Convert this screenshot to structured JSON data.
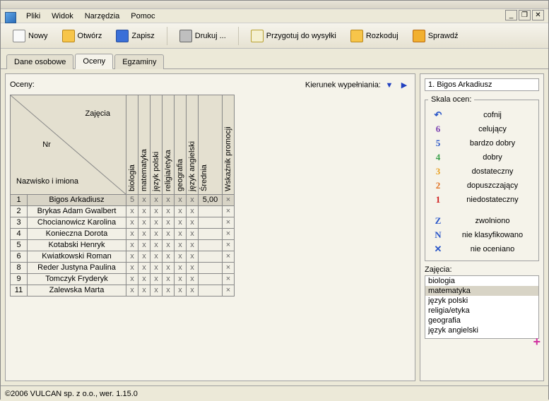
{
  "menus": [
    "Pliki",
    "Widok",
    "Narzędzia",
    "Pomoc"
  ],
  "toolbar": [
    {
      "label": "Nowy",
      "icon": "#f9f9f9",
      "border": "#888"
    },
    {
      "label": "Otwórz",
      "icon": "#f7c54a",
      "border": "#b8861a"
    },
    {
      "label": "Zapisz",
      "icon": "#3a6fd8",
      "border": "#2a4f9a"
    },
    {
      "sep": true
    },
    {
      "label": "Drukuj ...",
      "icon": "#bfbfbf",
      "border": "#666"
    },
    {
      "sep": true
    },
    {
      "label": "Przygotuj do wysyłki",
      "icon": "#f5f0d0",
      "border": "#b8a030"
    },
    {
      "label": "Rozkoduj",
      "icon": "#f7c54a",
      "border": "#b8861a"
    },
    {
      "label": "Sprawdź",
      "icon": "#f2b030",
      "border": "#b86a10"
    }
  ],
  "tabs": [
    {
      "label": "Dane osobowe",
      "active": false
    },
    {
      "label": "Oceny",
      "active": true
    },
    {
      "label": "Egzaminy",
      "active": false
    }
  ],
  "grades": {
    "label": "Oceny:",
    "direction_label": "Kierunek wypełniania:",
    "corner_top": "Zajęcia",
    "corner_nr": "Nr",
    "corner_bottom": "Nazwisko i imiona",
    "subjects": [
      "biologia",
      "matematyka",
      "język polski",
      "religia/etyka",
      "geografia",
      "język angielski"
    ],
    "avg_label": "Średnia",
    "promo_label": "Wskaźnik promocji",
    "rows": [
      {
        "nr": "1",
        "name": "Bigos Arkadiusz",
        "cells": [
          "5",
          "x",
          "x",
          "x",
          "x",
          "x"
        ],
        "avg": "5,00",
        "promo": "×",
        "hl": true
      },
      {
        "nr": "2",
        "name": "Brykas Adam Gwalbert",
        "cells": [
          "x",
          "x",
          "x",
          "x",
          "x",
          "x"
        ],
        "avg": "",
        "promo": "×"
      },
      {
        "nr": "3",
        "name": "Chocianowicz Karolina",
        "cells": [
          "x",
          "x",
          "x",
          "x",
          "x",
          "x"
        ],
        "avg": "",
        "promo": "×"
      },
      {
        "nr": "4",
        "name": "Konieczna Dorota",
        "cells": [
          "x",
          "x",
          "x",
          "x",
          "x",
          "x"
        ],
        "avg": "",
        "promo": "×"
      },
      {
        "nr": "5",
        "name": "Kotabski Henryk",
        "cells": [
          "x",
          "x",
          "x",
          "x",
          "x",
          "x"
        ],
        "avg": "",
        "promo": "×"
      },
      {
        "nr": "6",
        "name": "Kwiatkowski Roman",
        "cells": [
          "x",
          "x",
          "x",
          "x",
          "x",
          "x"
        ],
        "avg": "",
        "promo": "×"
      },
      {
        "nr": "8",
        "name": "Reder Justyna Paulina",
        "cells": [
          "x",
          "x",
          "x",
          "x",
          "x",
          "x"
        ],
        "avg": "",
        "promo": "×"
      },
      {
        "nr": "9",
        "name": "Tomczyk Fryderyk",
        "cells": [
          "x",
          "x",
          "x",
          "x",
          "x",
          "x"
        ],
        "avg": "",
        "promo": "×"
      },
      {
        "nr": "11",
        "name": "Zalewska Marta",
        "cells": [
          "x",
          "x",
          "x",
          "x",
          "x",
          "x"
        ],
        "avg": "",
        "promo": "×"
      }
    ]
  },
  "side": {
    "title": "1. Bigos Arkadiusz",
    "scale_legend": "Skala ocen:",
    "scale": [
      {
        "sym": "↶",
        "txt": "cofnij",
        "color": "#2a56c8"
      },
      {
        "sym": "6",
        "txt": "celujący",
        "color": "#7a3fb0"
      },
      {
        "sym": "5",
        "txt": "bardzo dobry",
        "color": "#2a56c8"
      },
      {
        "sym": "4",
        "txt": "dobry",
        "color": "#3aa04a"
      },
      {
        "sym": "3",
        "txt": "dostateczny",
        "color": "#e8a020"
      },
      {
        "sym": "2",
        "txt": "dopuszczający",
        "color": "#e07020"
      },
      {
        "sym": "1",
        "txt": "niedostateczny",
        "color": "#d02020"
      },
      {
        "sym": "Z",
        "txt": "zwolniono",
        "color": "#2a56c8"
      },
      {
        "sym": "N",
        "txt": "nie klasyfikowano",
        "color": "#2a56c8"
      },
      {
        "sym": "✕",
        "txt": "nie oceniano",
        "color": "#2a56c8"
      }
    ],
    "subjects_legend": "Zajęcia:",
    "subjects": [
      "biologia",
      "matematyka",
      "język polski",
      "religia/etyka",
      "geografia",
      "język angielski"
    ],
    "subject_selected": 1
  },
  "status": "©2006 VULCAN sp. z o.o., wer. 1.15.0"
}
